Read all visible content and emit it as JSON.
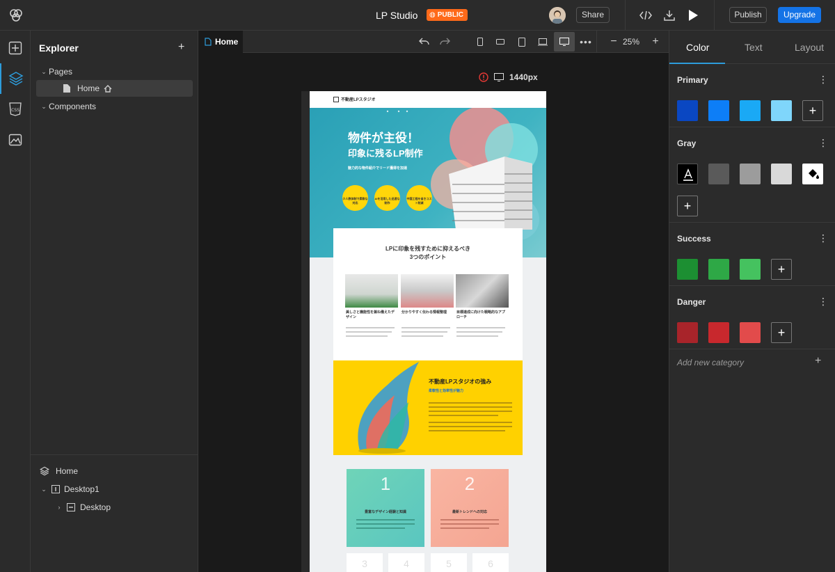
{
  "app": {
    "title": "LP Studio",
    "visibility_badge": "PUBLIC",
    "share_label": "Share",
    "publish_label": "Publish",
    "upgrade_label": "Upgrade",
    "accent_color": "#1473e6",
    "badge_color": "#ff6a1a"
  },
  "explorer": {
    "title": "Explorer",
    "tree": {
      "pages_label": "Pages",
      "home_label": "Home",
      "components_label": "Components"
    },
    "layers": {
      "root_label": "Home",
      "desktop1_label": "Desktop1",
      "desktop_label": "Desktop"
    }
  },
  "canvas": {
    "tab_label": "Home",
    "zoom_label": "25%",
    "artboard_width_label": "1440px"
  },
  "lp": {
    "logo_text": "不動産LPスタジオ",
    "hero_line1": "物件が主役！",
    "hero_line2": "印象に残るLP制作",
    "hero_sub": "魅力的な物件紹介でリード獲得を加速",
    "feature1": "少人数体制で柔軟な対応",
    "feature2": "AIを活用した迅速な制作",
    "feature3": "中国工程を省きコスト削減",
    "points_title_1": "LPに印象を残すために抑えるべき",
    "points_title_2": "3つのポイント",
    "point1_title": "美しさと機能性を兼ね備えたデザイン",
    "point2_title": "分かりやすく伝わる情報整理",
    "point3_title": "目標達成に向けた戦略的なアプローチ",
    "strength_title": "不動産LPスタジオの強み",
    "strength_sub": "柔軟性と効率性が魅力",
    "box1_num": "1",
    "box1_title": "豊富なデザイン経験と知識",
    "box2_num": "2",
    "box2_title": "最新トレンドへの対応",
    "small_nums": [
      "3",
      "4",
      "5",
      "6"
    ]
  },
  "inspector": {
    "tabs": [
      "Color",
      "Text",
      "Layout"
    ],
    "active_tab": "Color",
    "categories": [
      {
        "name": "Primary",
        "colors": [
          "#0a47c2",
          "#0d7ef7",
          "#1aa9f5",
          "#7fd6fb"
        ]
      },
      {
        "name": "Gray",
        "colors": [
          "#000000",
          "#5a5a5a",
          "#9c9c9c",
          "#d9d9d9",
          "#ffffff"
        ]
      },
      {
        "name": "Success",
        "colors": [
          "#1c8f32",
          "#2ea846",
          "#45c25f"
        ]
      },
      {
        "name": "Danger",
        "colors": [
          "#a8242a",
          "#c8282d",
          "#e24b4b"
        ]
      }
    ],
    "add_category_label": "Add new category"
  }
}
